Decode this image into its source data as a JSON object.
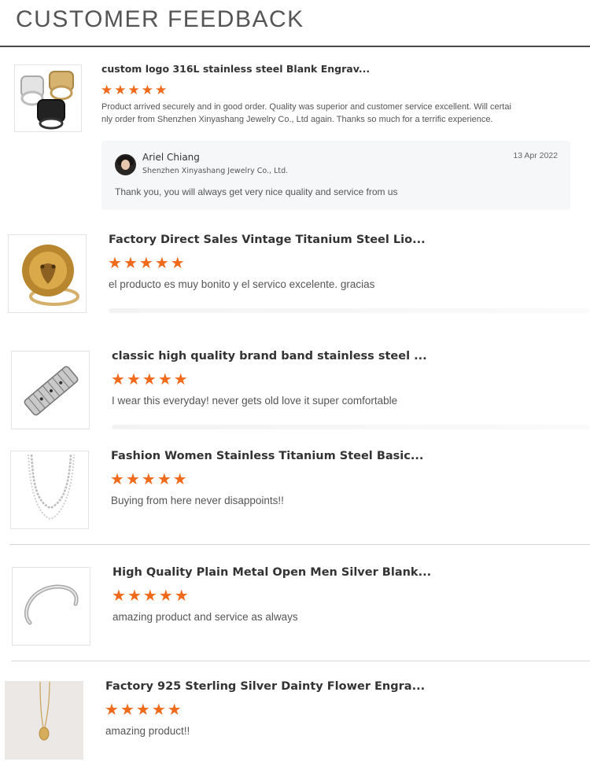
{
  "header": {
    "title": "CUSTOMER FEEDBACK"
  },
  "colors": {
    "star": "#f06a1b",
    "reply_bg": "#f6f7f9"
  },
  "reviews": [
    {
      "product_title": "custom logo 316L stainless steel Blank Engrav...",
      "rating": 5,
      "comment_line1": "Product arrived securely and in good order. Quality was superior and customer service excellent. Will certai",
      "comment_line2": "nly order from Shenzhen Xinyashang Jewelry Co., Ltd again. Thanks so much for a terrific experience.",
      "reply": {
        "name": "Ariel Chiang",
        "company": "Shenzhen Xinyashang Jewelry Co., Ltd.",
        "date": "13 Apr 2022",
        "text": "Thank you, you will always get very nice quality and service from us"
      }
    },
    {
      "product_title": "Factory Direct Sales Vintage Titanium Steel Lio...",
      "rating": 5,
      "comment": "el producto es muy bonito y el servico excelente. gracias"
    },
    {
      "product_title": "classic high quality brand band stainless steel ...",
      "rating": 5,
      "comment": "I wear this everyday! never gets old love it super comfortable"
    },
    {
      "product_title": "Fashion Women Stainless Titanium Steel Basic...",
      "rating": 5,
      "comment": "Buying from here never disappoints!!"
    },
    {
      "product_title": "High Quality Plain Metal Open Men Silver Blank...",
      "rating": 5,
      "comment": "amazing product and service as always"
    },
    {
      "product_title": "Factory 925 Sterling Silver Dainty Flower Engra...",
      "rating": 5,
      "comment": "amazing product!!"
    }
  ]
}
